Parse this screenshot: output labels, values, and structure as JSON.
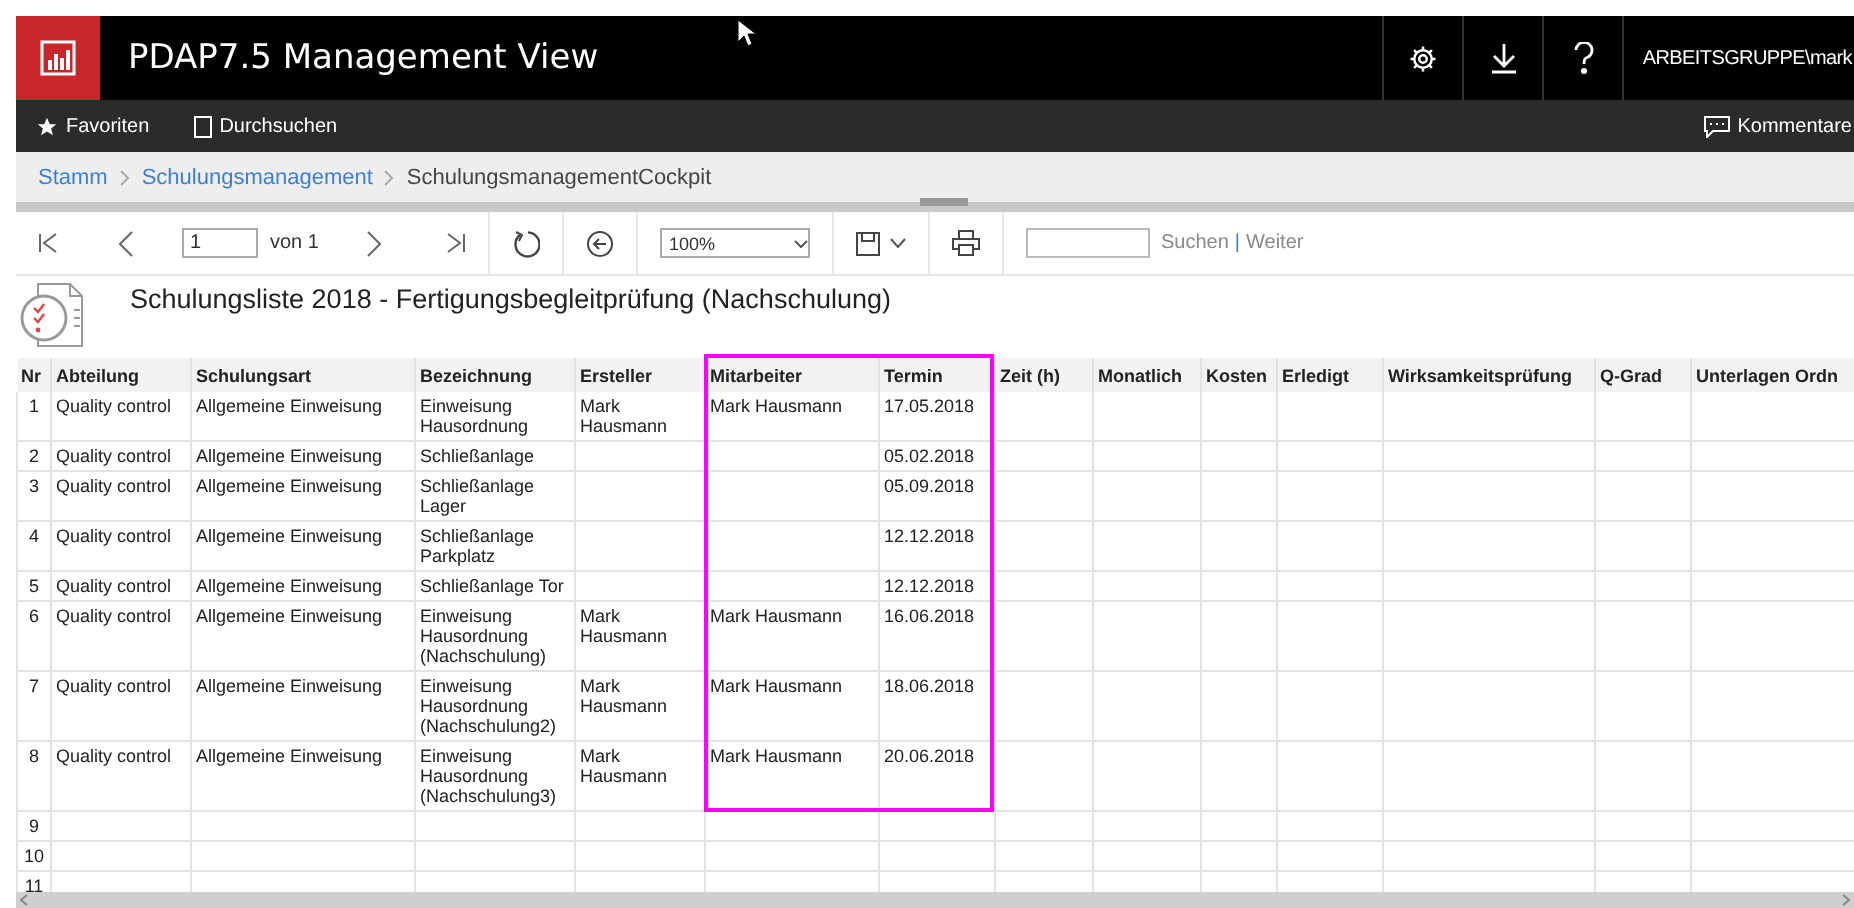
{
  "app": {
    "title": "PDAP7.5 Management View",
    "user": "ARBEITSGRUPPE\\mark"
  },
  "nav": {
    "items": [
      "Favoriten",
      "Durchsuchen"
    ],
    "comments": "Kommentare"
  },
  "breadcrumb": [
    {
      "label": "Stamm",
      "link": true
    },
    {
      "label": "Schulungsmanagement",
      "link": true
    },
    {
      "label": "SchulungsmanagementCockpit",
      "link": false
    }
  ],
  "toolbar": {
    "page": "1",
    "page_of": "von 1",
    "zoom": "100%",
    "search_button": "Suchen",
    "separator": "|",
    "next_button": "Weiter"
  },
  "report": {
    "title": "Schulungsliste 2018 - Fertigungsbegleitprüfung (Nachschulung)"
  },
  "table": {
    "columns": [
      {
        "label": "Nr",
        "highlighted": false
      },
      {
        "label": "Abteilung",
        "highlighted": false
      },
      {
        "label": "Schulungsart",
        "highlighted": false
      },
      {
        "label": "Bezeichnung",
        "highlighted": false
      },
      {
        "label": "Ersteller",
        "highlighted": false
      },
      {
        "label": "Mitarbeiter",
        "highlighted": true
      },
      {
        "label": "Termin",
        "highlighted": true
      },
      {
        "label": "Zeit (h)",
        "highlighted": false
      },
      {
        "label": "Monatlich",
        "highlighted": false
      },
      {
        "label": "Kosten",
        "highlighted": false
      },
      {
        "label": "Erledigt",
        "highlighted": false
      },
      {
        "label": "Wirksamkeitsprüfung",
        "highlighted": false
      },
      {
        "label": "Q-Grad",
        "highlighted": false
      },
      {
        "label": "Unterlagen Ordn",
        "highlighted": false
      }
    ],
    "rows": [
      [
        "1",
        "Quality control",
        "Allgemeine Einweisung",
        "Einweisung Hausordnung",
        "Mark Hausmann",
        "Mark Hausmann",
        "17.05.2018"
      ],
      [
        "2",
        "Quality control",
        "Allgemeine Einweisung",
        "Schließanlage",
        "",
        "",
        "05.02.2018"
      ],
      [
        "3",
        "Quality control",
        "Allgemeine Einweisung",
        "Schließanlage Lager",
        "",
        "",
        "05.09.2018"
      ],
      [
        "4",
        "Quality control",
        "Allgemeine Einweisung",
        "Schließanlage Parkplatz",
        "",
        "",
        "12.12.2018"
      ],
      [
        "5",
        "Quality control",
        "Allgemeine Einweisung",
        "Schließanlage Tor",
        "",
        "",
        "12.12.2018"
      ],
      [
        "6",
        "Quality control",
        "Allgemeine Einweisung",
        "Einweisung Hausordnung (Nachschulung)",
        "Mark Hausmann",
        "Mark Hausmann",
        "16.06.2018"
      ],
      [
        "7",
        "Quality control",
        "Allgemeine Einweisung",
        "Einweisung Hausordnung (Nachschulung2)",
        "Mark Hausmann",
        "Mark Hausmann",
        "18.06.2018"
      ],
      [
        "8",
        "Quality control",
        "Allgemeine Einweisung",
        "Einweisung Hausordnung (Nachschulung3)",
        "Mark Hausmann",
        "Mark Hausmann",
        "20.06.2018"
      ],
      [
        "9"
      ],
      [
        "10"
      ],
      [
        "11"
      ]
    ]
  }
}
